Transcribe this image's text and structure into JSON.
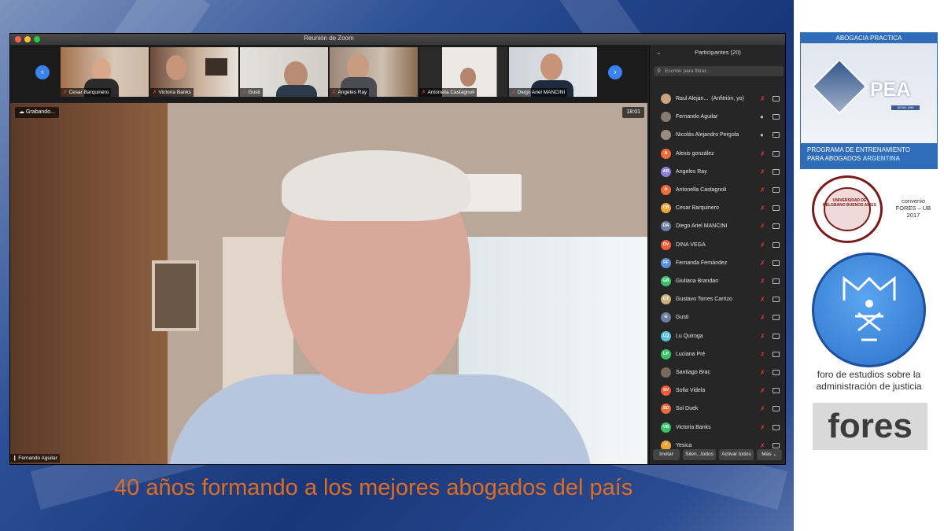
{
  "window": {
    "title": "Reunión de Zoom"
  },
  "thumbnails": [
    {
      "name": "Cesar Barquinero",
      "muted": true
    },
    {
      "name": "Victoria Banks",
      "muted": true
    },
    {
      "name": "Gusti",
      "muted": true
    },
    {
      "name": "Angeles Ray",
      "muted": true
    },
    {
      "name": "Antonella Castagnoli",
      "muted": true
    },
    {
      "name": "Diego Ariel MANCINI",
      "muted": true
    }
  ],
  "video": {
    "recording_label": "Grabando...",
    "time": "18:01",
    "speaker": "Fernando Aguilar"
  },
  "participants_panel": {
    "header": "Participantes (20)",
    "search_placeholder": "Escribir para filtrar...",
    "participants": [
      {
        "name": "Raul Alejan...",
        "role": "(Anfitrión, yo)",
        "initials": "",
        "color": "#c9a27e",
        "muted": true
      },
      {
        "name": "Fernando Aguilar",
        "initials": "",
        "color": "#8a7b70",
        "muted": false
      },
      {
        "name": "Nicolás Alejandro Pergola",
        "initials": "",
        "color": "#9a8c80",
        "muted": false
      },
      {
        "name": "Alexis gonzález",
        "initials": "A",
        "color": "#f26b3a",
        "muted": true
      },
      {
        "name": "Angeles Ray",
        "initials": "AR",
        "color": "#8f7ee0",
        "muted": true
      },
      {
        "name": "Antonella Castagnoli",
        "initials": "A",
        "color": "#f26b3a",
        "muted": true
      },
      {
        "name": "Cesar Barquinero",
        "initials": "CB",
        "color": "#f2a33a",
        "muted": true
      },
      {
        "name": "Diego Ariel MANCINI",
        "initials": "DA",
        "color": "#6b7fa3",
        "muted": true
      },
      {
        "name": "DINA VEGA",
        "initials": "DV",
        "color": "#f25a3a",
        "muted": true
      },
      {
        "name": "Fernanda Fernández",
        "initials": "FF",
        "color": "#5b8fd9",
        "muted": true
      },
      {
        "name": "Giuliana Brandan",
        "initials": "GB",
        "color": "#3ac26b",
        "muted": true
      },
      {
        "name": "Gustavo Torres Carrizo",
        "initials": "GT",
        "color": "#c9b27e",
        "muted": true
      },
      {
        "name": "Gusti",
        "initials": "G",
        "color": "#6b7fa3",
        "muted": true
      },
      {
        "name": "Lu Quiroga",
        "initials": "LQ",
        "color": "#5bc2e0",
        "muted": true
      },
      {
        "name": "Luciana Pré",
        "initials": "LP",
        "color": "#3ac26b",
        "muted": true
      },
      {
        "name": "Santiago Brac",
        "initials": "",
        "color": "#7a6a5e",
        "muted": true
      },
      {
        "name": "Sofia Videla",
        "initials": "SV",
        "color": "#f25a3a",
        "muted": true
      },
      {
        "name": "Sol Duek",
        "initials": "SD",
        "color": "#f26b3a",
        "muted": true
      },
      {
        "name": "Victoria Banks",
        "initials": "VB",
        "color": "#3ac26b",
        "muted": true
      },
      {
        "name": "Yesica",
        "initials": "Y",
        "color": "#f2a33a",
        "muted": true
      }
    ],
    "buttons": {
      "invite": "Invitar",
      "mute_all": "Silen...todos",
      "unmute_all": "Activar todos",
      "more": "Más"
    }
  },
  "sidebar": {
    "pea_top": "ABOGACIA PRACTICA",
    "pea_logo_text": "PEA",
    "pea_since": "DESDE 1980",
    "pea_program_line1": "PROGRAMA DE ENTRENAMIENTO",
    "pea_program_line2": "PARA ABOGADOS",
    "pea_country": "ARGENTINA",
    "ub_seal_text": "UNIVERSIDAD DE BELGRANO BUENOS AIRES",
    "convenio_line1": "convenio",
    "convenio_line2": "FORES – UB",
    "convenio_line3": "2017",
    "fores_desc": "foro de estudios sobre la administración de justicia",
    "fores_word": "fores"
  },
  "tagline": "40 años formando a los mejores abogados del país",
  "colors": {
    "zoom_blue": "#3b82f0",
    "muted_red": "#e53935",
    "tagline_orange": "#e06c1f",
    "pea_blue": "#2f6db8"
  }
}
